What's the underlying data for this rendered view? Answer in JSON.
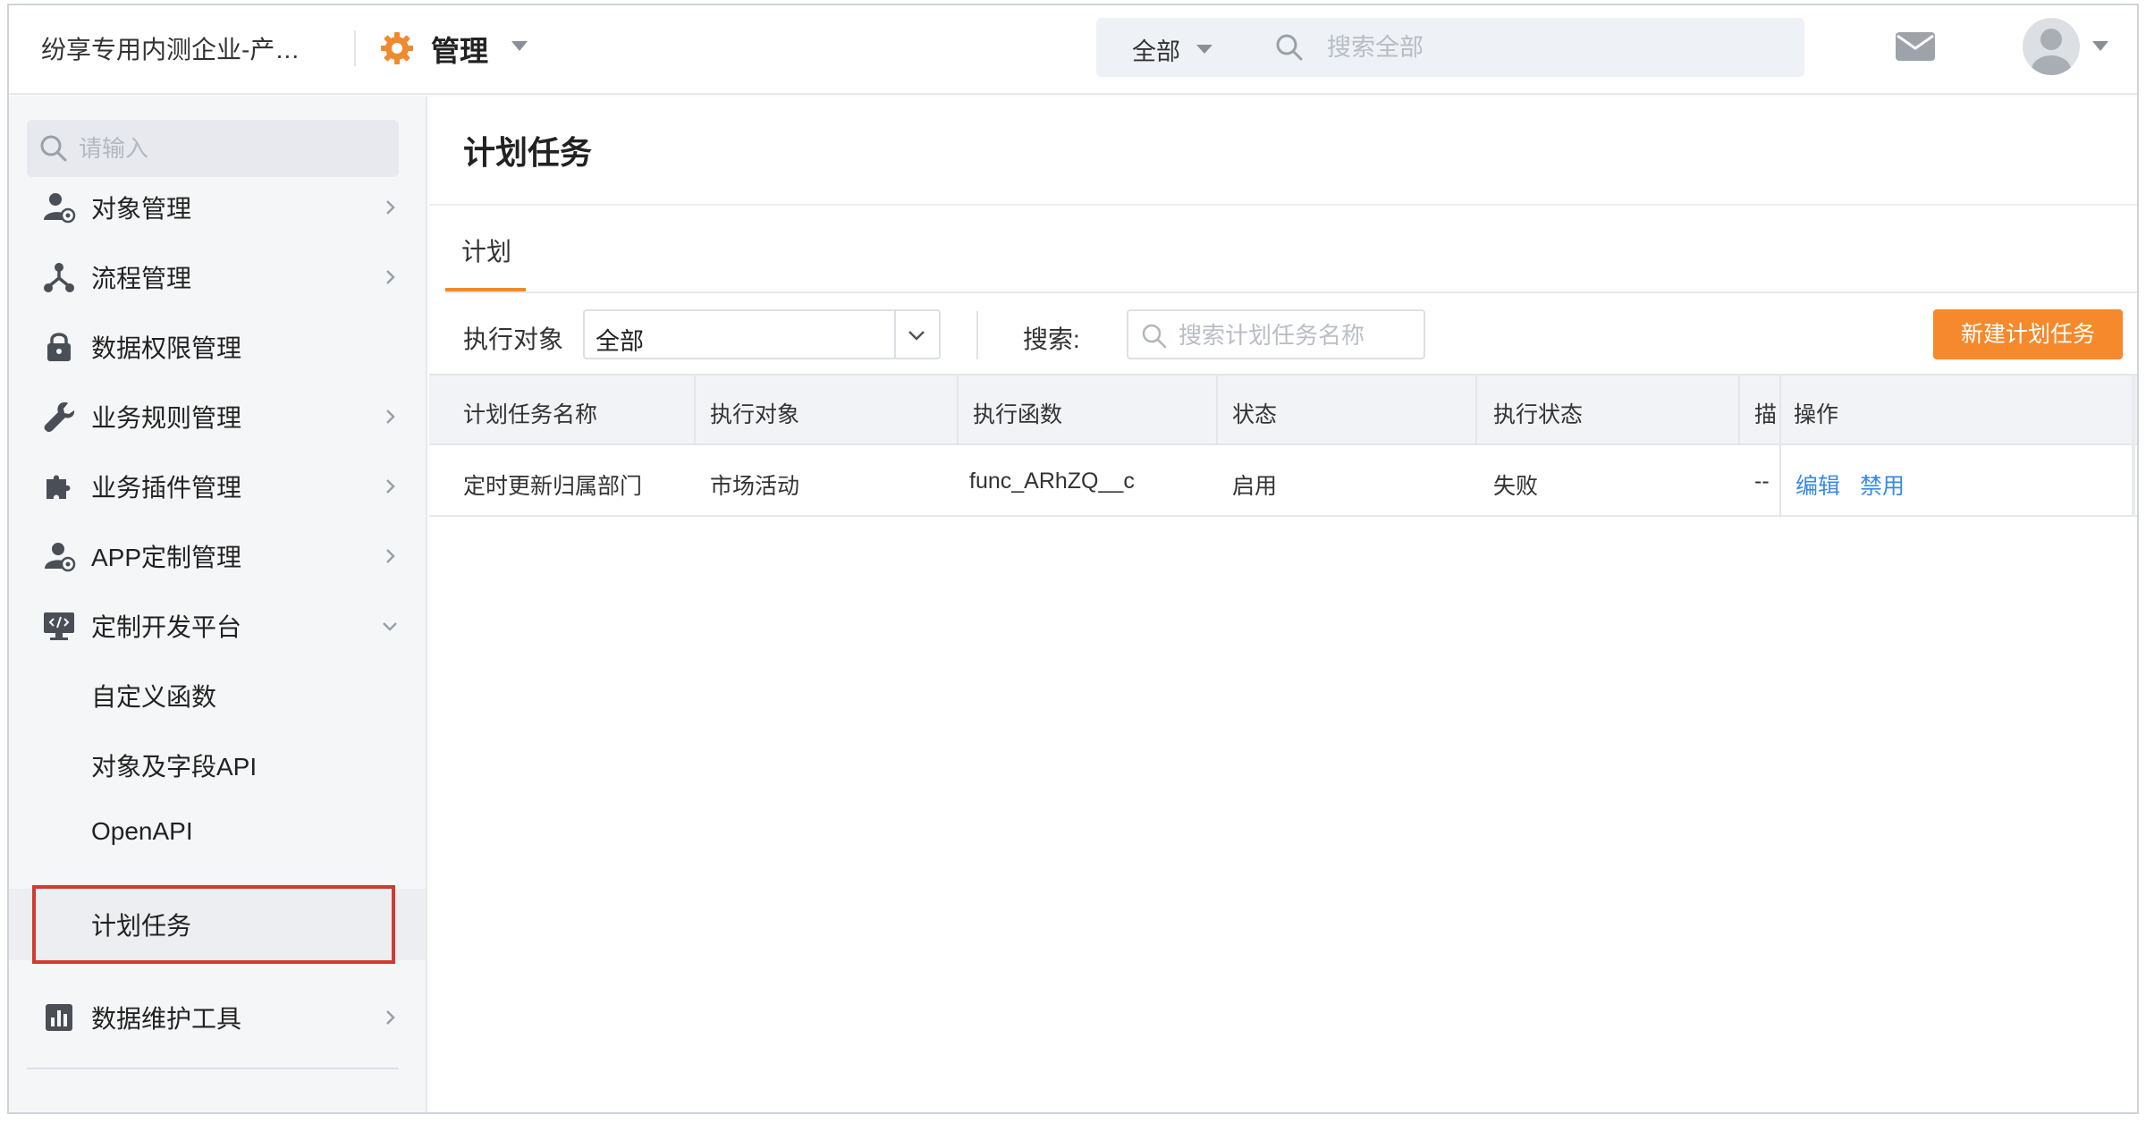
{
  "header": {
    "company": "纷享专用内测企业-产…",
    "module_title": "管理",
    "search": {
      "scope": "全部",
      "placeholder": "搜索全部"
    }
  },
  "sidebar": {
    "search_placeholder": "请输入",
    "items": [
      {
        "label": "对象管理",
        "icon": "object-manage-icon",
        "has_children": true
      },
      {
        "label": "流程管理",
        "icon": "flow-icon",
        "has_children": true
      },
      {
        "label": "数据权限管理",
        "icon": "lock-icon",
        "has_children": false
      },
      {
        "label": "业务规则管理",
        "icon": "wrench-icon",
        "has_children": true
      },
      {
        "label": "业务插件管理",
        "icon": "puzzle-icon",
        "has_children": true
      },
      {
        "label": "APP定制管理",
        "icon": "app-settings-icon",
        "has_children": true
      },
      {
        "label": "定制开发平台",
        "icon": "code-monitor-icon",
        "has_children": true,
        "expanded": true
      },
      {
        "label": "数据维护工具",
        "icon": "bar-chart-icon",
        "has_children": true
      }
    ],
    "sub_items": [
      {
        "label": "自定义函数"
      },
      {
        "label": "对象及字段API"
      },
      {
        "label": "OpenAPI"
      },
      {
        "label": "计划任务",
        "active": true
      }
    ]
  },
  "main": {
    "title": "计划任务",
    "tab": "计划",
    "filter": {
      "label": "执行对象",
      "value": "全部",
      "search_label": "搜索:",
      "search_placeholder": "搜索计划任务名称"
    },
    "new_button": "新建计划任务",
    "table": {
      "columns": [
        "计划任务名称",
        "执行对象",
        "执行函数",
        "状态",
        "执行状态",
        "描",
        "操作"
      ],
      "rows": [
        {
          "name": "定时更新归属部门",
          "object": "市场活动",
          "function": "func_ARhZQ__c",
          "status": "启用",
          "exec_status": "失败",
          "desc": "--",
          "actions": [
            "编辑",
            "禁用"
          ]
        }
      ]
    }
  },
  "colors": {
    "accent_orange": "#f5892c",
    "link_blue": "#3a8ae6",
    "highlight_red": "#d03a30"
  }
}
